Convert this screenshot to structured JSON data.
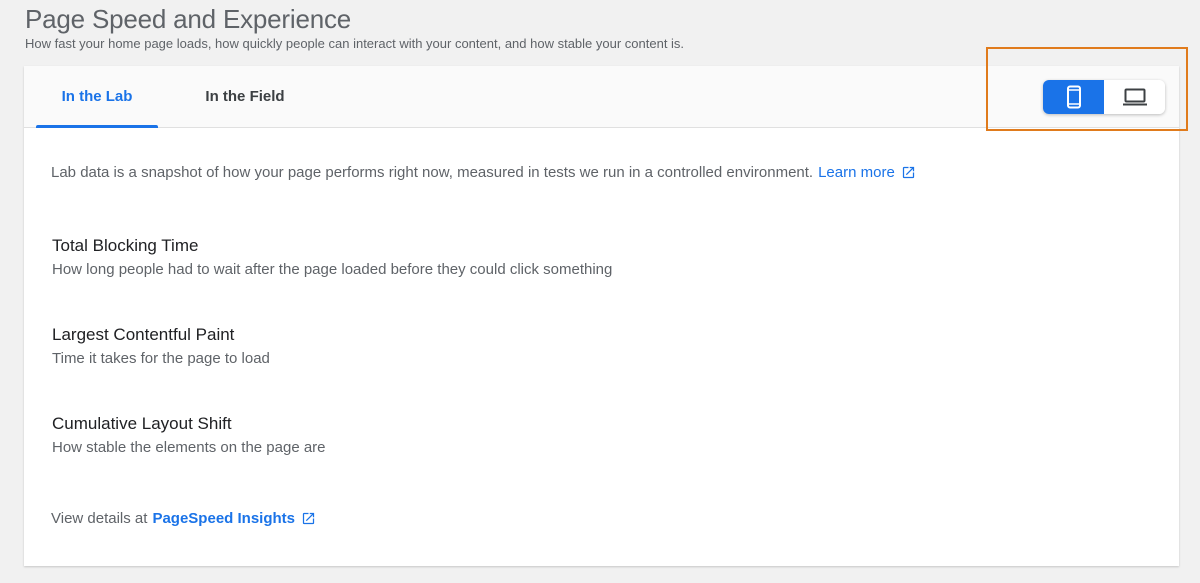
{
  "header": {
    "title": "Page Speed and Experience",
    "subtitle": "How fast your home page loads, how quickly people can interact with your content, and how stable your content is."
  },
  "tabs": [
    {
      "label": "In the Lab",
      "active": true
    },
    {
      "label": "In the Field",
      "active": false
    }
  ],
  "device_toggle": {
    "selected": "mobile",
    "options": [
      {
        "icon": "mobile-phone-icon"
      },
      {
        "icon": "laptop-icon"
      }
    ]
  },
  "intro": {
    "text": "Lab data is a snapshot of how your page performs right now, measured in tests we run in a controlled environment.",
    "link_label": "Learn more"
  },
  "metrics": [
    {
      "title": "Total Blocking Time",
      "description": "How long people had to wait after the page loaded before they could click something"
    },
    {
      "title": "Largest Contentful Paint",
      "description": "Time it takes for the page to load"
    },
    {
      "title": "Cumulative Layout Shift",
      "description": "How stable the elements on the page are"
    }
  ],
  "footer": {
    "text": "View details at",
    "link_label": "PageSpeed Insights"
  },
  "colors": {
    "accent": "#1a73e8",
    "highlight": "#e07b1c",
    "muted_text": "#5f6368",
    "background": "#f1f1f1"
  }
}
